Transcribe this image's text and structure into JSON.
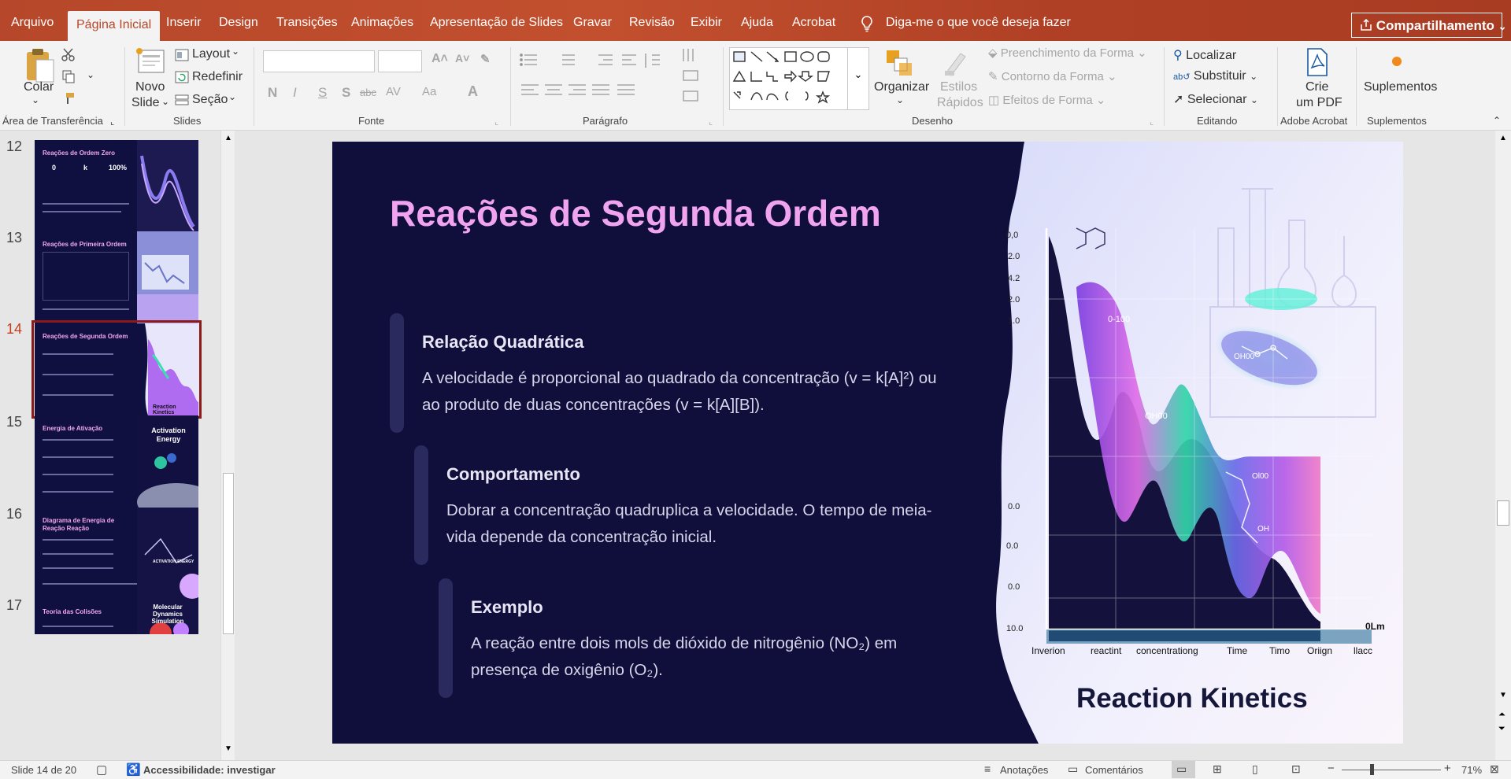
{
  "ribbon_tabs": [
    "Arquivo",
    "Página Inicial",
    "Inserir",
    "Design",
    "Transições",
    "Animações",
    "Apresentação de Slides",
    "Gravar",
    "Revisão",
    "Exibir",
    "Ajuda",
    "Acrobat"
  ],
  "tell_me": "Diga-me o que você deseja fazer",
  "share_label": "Compartilhamento",
  "clipboard": {
    "paste": "Colar",
    "group": "Área de Transferência"
  },
  "slides_group": {
    "new_slide_1": "Novo",
    "new_slide_2": "Slide",
    "layout": "Layout",
    "reset": "Redefinir",
    "section": "Seção",
    "group": "Slides"
  },
  "font_group": {
    "group": "Fonte",
    "bold": "N",
    "italic": "I",
    "underline": "S",
    "shadow": "S",
    "strike": "abc",
    "spacing": "AV",
    "case": "Aa",
    "color": "A"
  },
  "paragraph_group": {
    "group": "Parágrafo"
  },
  "drawing_group": {
    "organize": "Organizar",
    "styles_1": "Estilos",
    "styles_2": "Rápidos",
    "fill": "Preenchimento da Forma",
    "outline": "Contorno da Forma",
    "effects": "Efeitos de Forma",
    "group": "Desenho"
  },
  "editing_group": {
    "find": "Localizar",
    "replace": "Substituir",
    "select": "Selecionar",
    "group": "Editando"
  },
  "acrobat_group": {
    "create_1": "Crie",
    "create_2": "um PDF",
    "group": "Adobe Acrobat"
  },
  "addins_group": {
    "label": "Suplementos",
    "group": "Suplementos"
  },
  "thumbnails": [
    {
      "num": "12",
      "title": "Reações de Ordem Zero",
      "stats": [
        "0",
        "k",
        "100%"
      ]
    },
    {
      "num": "13",
      "title": "Reações de Primeira Ordem"
    },
    {
      "num": "14",
      "title": "Reações de Segunda Ordem",
      "caption": "Reaction Kinetics"
    },
    {
      "num": "15",
      "title": "Energia de Ativação",
      "caption": "Activation Energy"
    },
    {
      "num": "16",
      "title": "Diagrama de Energia de Reação Reação",
      "caption": "ACTIVATION ENERGY"
    },
    {
      "num": "17",
      "title": "Teoria das Colisões",
      "caption": "Molecular Dynamics Simulation"
    }
  ],
  "slide": {
    "title": "Reações de Segunda Ordem",
    "sections": [
      {
        "heading": "Relação Quadrática",
        "body": "A velocidade é proporcional ao quadrado da concentração (v = k[A]²) ou ao produto de duas concentrações (v = k[A][B])."
      },
      {
        "heading": "Comportamento",
        "body": "Dobrar a concentração quadruplica a velocidade. O tempo de meia-vida depende da concentração inicial."
      },
      {
        "heading": "Exemplo",
        "body": "A reação entre dois mols de dióxido de nitrogênio (NO₂) em presença de oxigênio (O₂)."
      }
    ],
    "image": {
      "caption": "Reaction Kinetics",
      "x_labels": [
        "Inverion",
        "reactint",
        "concentrationg",
        "Time",
        "Timo",
        "Oriign",
        "llacc"
      ],
      "y_labels": [
        "0,0",
        "2.0",
        "4.2",
        "2.0",
        "1.0",
        "0.0",
        "0.0",
        "0.0",
        "10.0"
      ],
      "axis_end": "0Lm",
      "molecule_labels": [
        "0-100",
        "OH00",
        "OH00",
        "Ol00",
        "OH"
      ]
    }
  },
  "status": {
    "slide_info": "Slide 14 de 20",
    "accessibility": "Accessibilidade: investigar",
    "notes": "Anotações",
    "comments": "Comentários",
    "zoom": "71%"
  }
}
